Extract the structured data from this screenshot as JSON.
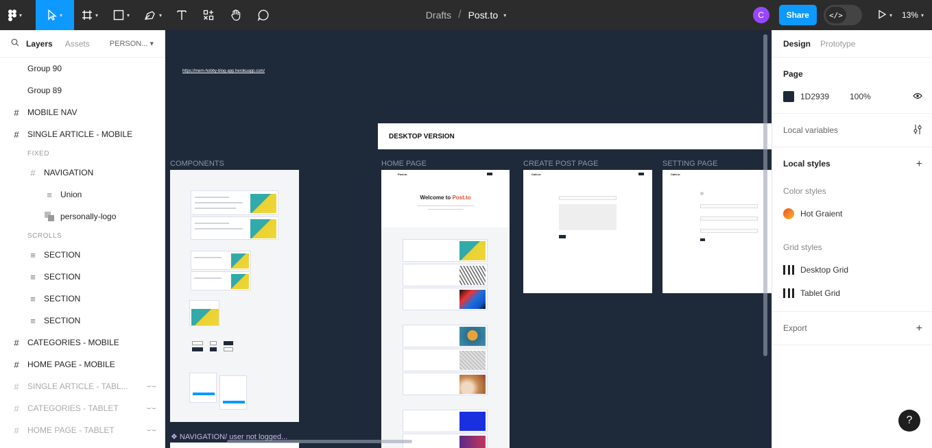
{
  "toolbar": {
    "file_drafts": "Drafts",
    "file_name": "Post.to",
    "avatar_initial": "C",
    "share_label": "Share",
    "devmode_label": "</>",
    "zoom": "13%"
  },
  "left_panel": {
    "tabs": [
      "Layers",
      "Assets"
    ],
    "page_selector": "PERSON...",
    "layers": [
      {
        "label": "Group 90"
      },
      {
        "label": "Group 89"
      },
      {
        "label": "MOBILE NAV"
      },
      {
        "label": "SINGLE ARTICLE - MOBILE"
      },
      {
        "label": "FIXED"
      },
      {
        "label": "NAVIGATION"
      },
      {
        "label": "Union"
      },
      {
        "label": "personally-logo"
      },
      {
        "label": "SCROLLS"
      },
      {
        "label": "SECTION"
      },
      {
        "label": "SECTION"
      },
      {
        "label": "SECTION"
      },
      {
        "label": "SECTION"
      },
      {
        "label": "CATEGORIES - MOBILE"
      },
      {
        "label": "HOME PAGE - MOBILE"
      },
      {
        "label": "SINGLE ARTICLE - TABL..."
      },
      {
        "label": "CATEGORIES - TABLET"
      },
      {
        "label": "HOME PAGE - TABLET"
      }
    ]
  },
  "right_panel": {
    "tabs": [
      "Design",
      "Prototype"
    ],
    "page_title": "Page",
    "page_color": "1D2939",
    "page_opacity": "100%",
    "local_variables": "Local variables",
    "local_styles": "Local styles",
    "color_styles": "Color styles",
    "color_style_name": "Hot Graient",
    "grid_styles": "Grid styles",
    "grids": [
      "Desktop Grid",
      "Tablet Grid"
    ],
    "export": "Export",
    "colors": {
      "page": "#1D2939",
      "hot_start": "#f04e23",
      "hot_end": "#f7b733"
    }
  },
  "canvas": {
    "url": "https://mern-hobby-blog-app.herokuapp.com/",
    "desktop_banner": "DESKTOP VERSION",
    "labels": {
      "components": "COMPONENTS",
      "home": "HOME PAGE",
      "create": "CREATE POST PAGE",
      "setting": "SETTING PAGE"
    },
    "nav_component": "❖ NAVIGATION/ user not logged...",
    "hero_title_part1": "Welcome to ",
    "hero_title_part2": "Post.to",
    "logo": "Post.to",
    "logo2": "Cath.io"
  },
  "help": "?"
}
